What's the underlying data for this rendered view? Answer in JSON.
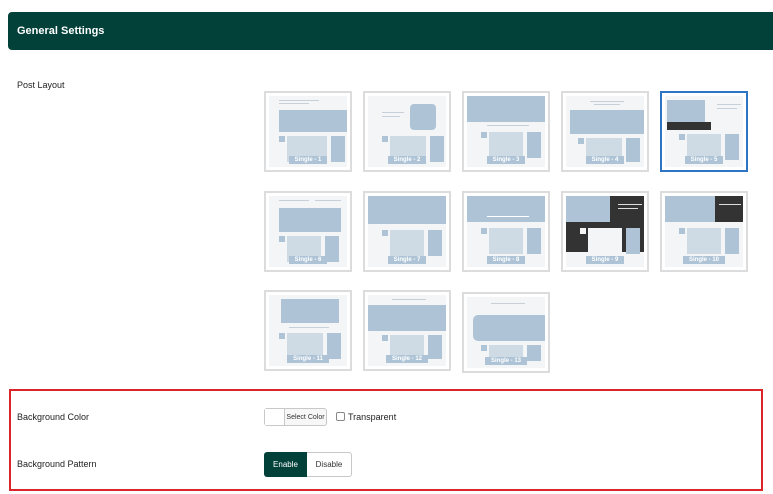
{
  "header": {
    "title": "General Settings"
  },
  "post_layout": {
    "label": "Post Layout",
    "selected": "Single - 5",
    "options": [
      "Single - 1",
      "Single - 2",
      "Single - 3",
      "Single - 4",
      "Single - 5",
      "Single - 6",
      "Single - 7",
      "Single - 8",
      "Single - 9",
      "Single - 10",
      "Single - 11",
      "Single - 12",
      "Single - 13"
    ]
  },
  "background_color": {
    "label": "Background Color",
    "button_label": "Select Color",
    "transparent_label": "Transparent",
    "transparent_checked": false
  },
  "background_pattern": {
    "label": "Background Pattern",
    "options": [
      "Enable",
      "Disable"
    ],
    "selected": "Enable"
  },
  "colors": {
    "header_bg": "#02403a",
    "selected_border": "#2b75c4",
    "highlight_border": "#d9262a",
    "placeholder": "#aec4d6"
  }
}
